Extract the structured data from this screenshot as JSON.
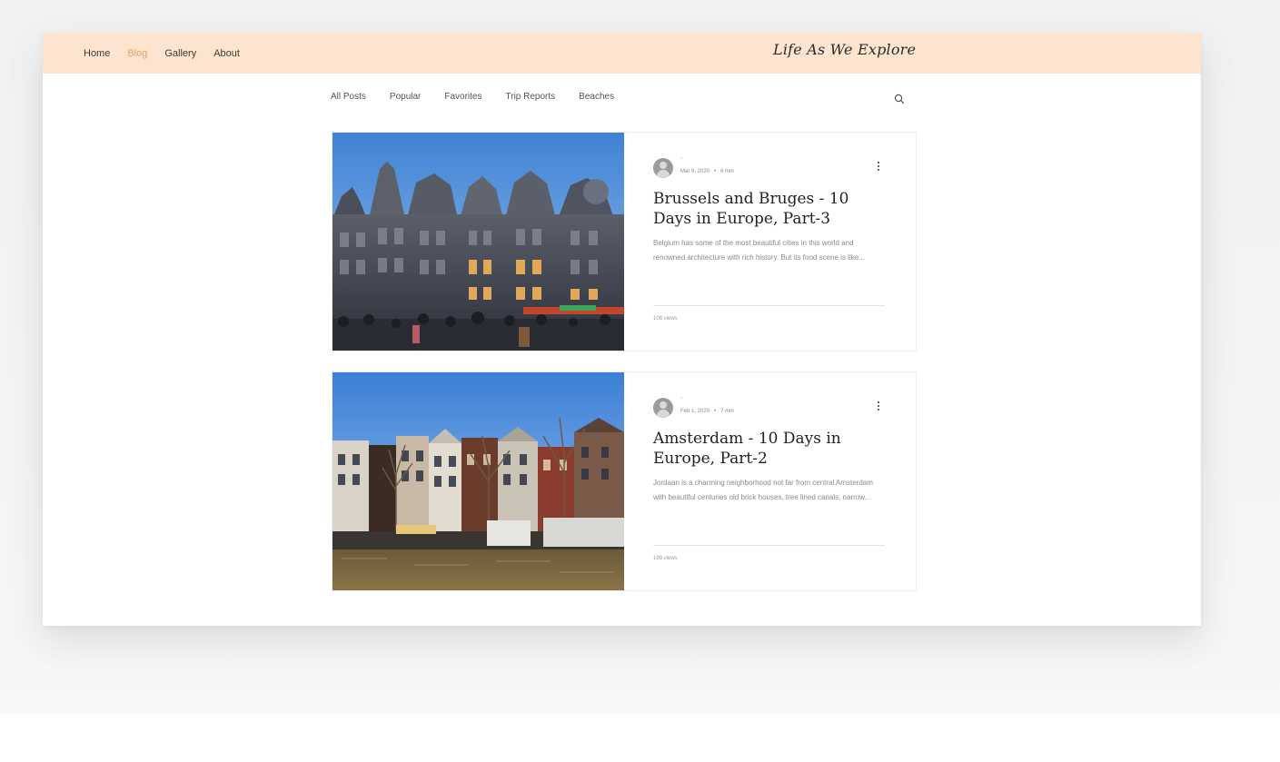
{
  "header": {
    "nav": [
      "Home",
      "Blog",
      "Gallery",
      "About"
    ],
    "active": "Blog",
    "logo_text": "Life As We Explore",
    "bg_color": "#fde4cf",
    "accent_color": "#e3a36a"
  },
  "categories": [
    "All Posts",
    "Popular",
    "Favorites",
    "Trip Reports",
    "Beaches"
  ],
  "search": {
    "icon": "search-icon"
  },
  "posts": [
    {
      "author": "-",
      "date": "Mar 9, 2020",
      "read_time": "6 min",
      "title": "Brussels and Bruges - 10 Days in Europe, Part-3",
      "excerpt": "Belgium has some of the most beautiful cities in this world and renowned architecture with rich history. But its food scene is like...",
      "views": "108 views",
      "image": "grand-place-guildhalls-photo"
    },
    {
      "author": "-",
      "date": "Feb 1, 2020",
      "read_time": "7 min",
      "title": "Amsterdam - 10 Days in Europe, Part-2",
      "excerpt": "Jordaan is a charming neighborhood not far from central Amsterdam with beautiful centuries old brick houses, tree lined canals, narrow...",
      "views": "199 views",
      "image": "amsterdam-canal-houses-photo"
    }
  ]
}
